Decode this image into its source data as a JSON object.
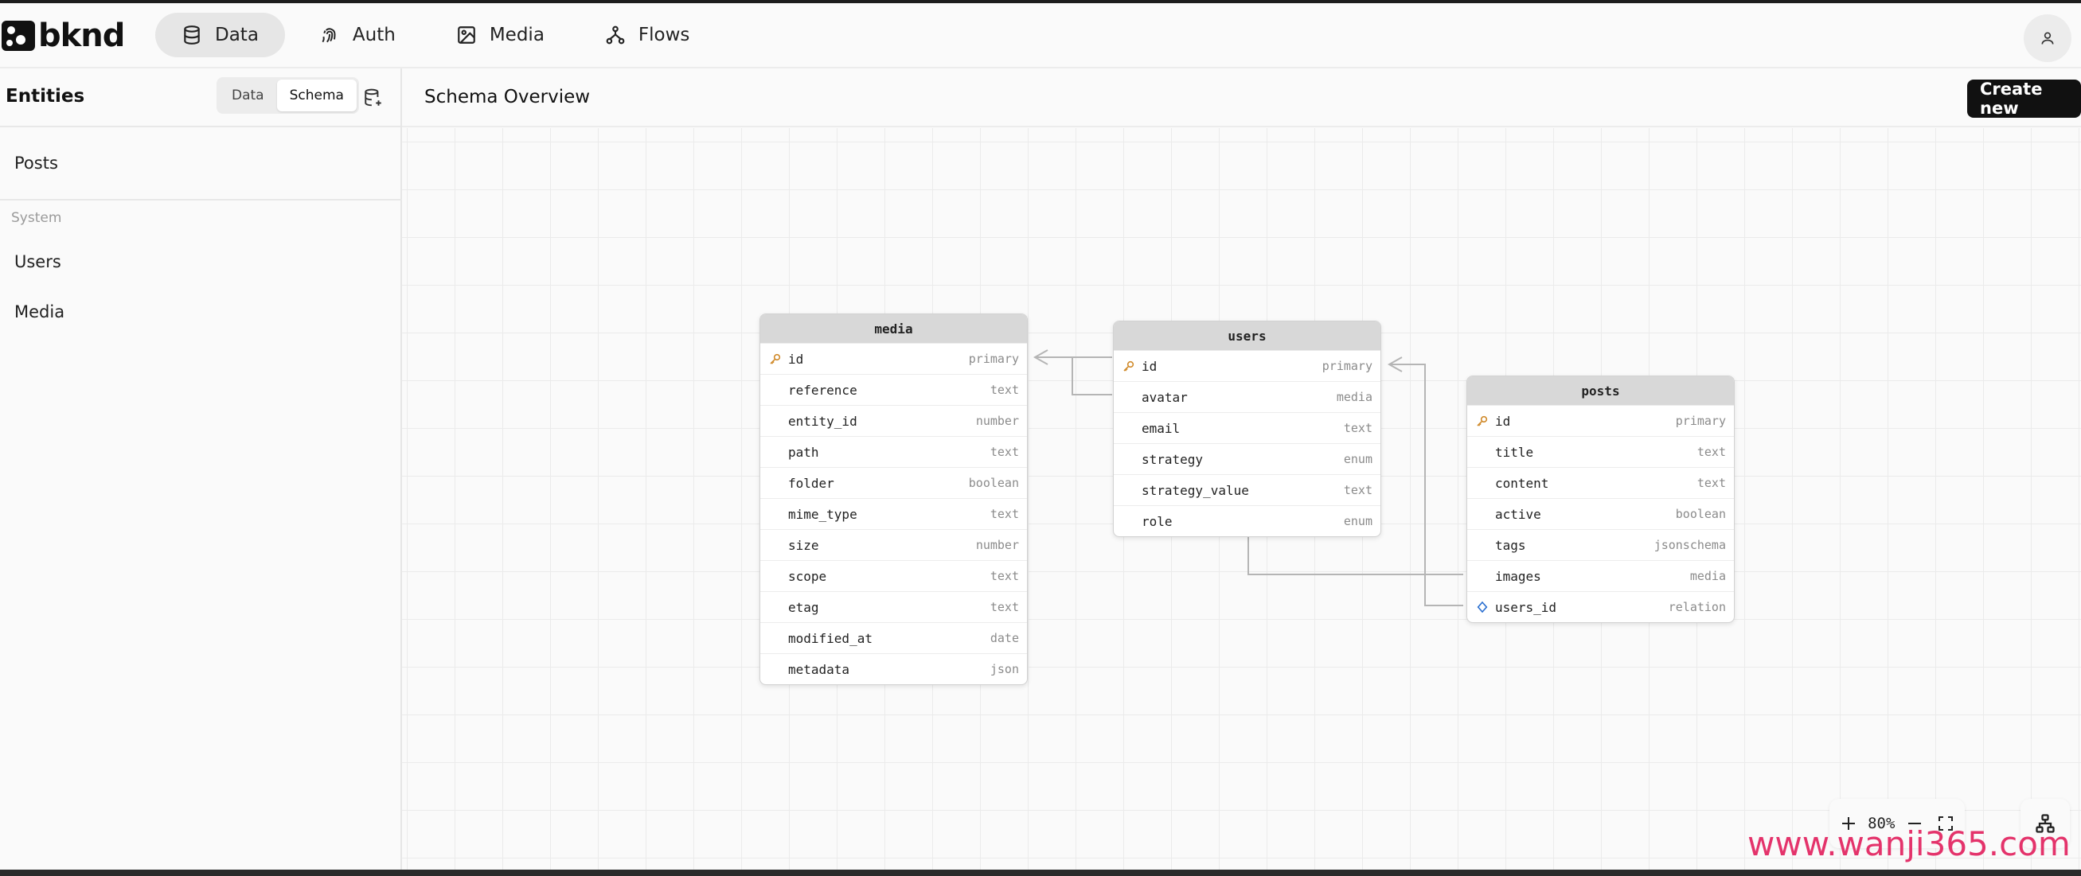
{
  "app": {
    "brand": "bknd"
  },
  "nav": [
    {
      "label": "Data",
      "icon": "database-icon",
      "active": true
    },
    {
      "label": "Auth",
      "icon": "fingerprint-icon",
      "active": false
    },
    {
      "label": "Media",
      "icon": "image-icon",
      "active": false
    },
    {
      "label": "Flows",
      "icon": "flow-icon",
      "active": false
    }
  ],
  "sidebar": {
    "title": "Entities",
    "view_toggle": {
      "data_label": "Data",
      "schema_label": "Schema",
      "selected": "Schema"
    },
    "items": [
      {
        "label": "Posts"
      }
    ],
    "system_section": "System",
    "system_items": [
      {
        "label": "Users"
      },
      {
        "label": "Media"
      }
    ]
  },
  "main": {
    "title": "Schema Overview",
    "create_label": "Create new"
  },
  "schema": {
    "media": {
      "name": "media",
      "fields": [
        {
          "name": "id",
          "type": "primary",
          "icon": "key-icon"
        },
        {
          "name": "reference",
          "type": "text"
        },
        {
          "name": "entity_id",
          "type": "number"
        },
        {
          "name": "path",
          "type": "text"
        },
        {
          "name": "folder",
          "type": "boolean"
        },
        {
          "name": "mime_type",
          "type": "text"
        },
        {
          "name": "size",
          "type": "number"
        },
        {
          "name": "scope",
          "type": "text"
        },
        {
          "name": "etag",
          "type": "text"
        },
        {
          "name": "modified_at",
          "type": "date"
        },
        {
          "name": "metadata",
          "type": "json"
        }
      ]
    },
    "users": {
      "name": "users",
      "fields": [
        {
          "name": "id",
          "type": "primary",
          "icon": "key-icon"
        },
        {
          "name": "avatar",
          "type": "media"
        },
        {
          "name": "email",
          "type": "text"
        },
        {
          "name": "strategy",
          "type": "enum"
        },
        {
          "name": "strategy_value",
          "type": "text"
        },
        {
          "name": "role",
          "type": "enum"
        }
      ]
    },
    "posts": {
      "name": "posts",
      "fields": [
        {
          "name": "id",
          "type": "primary",
          "icon": "key-icon"
        },
        {
          "name": "title",
          "type": "text"
        },
        {
          "name": "content",
          "type": "text"
        },
        {
          "name": "active",
          "type": "boolean"
        },
        {
          "name": "tags",
          "type": "jsonschema"
        },
        {
          "name": "images",
          "type": "media"
        },
        {
          "name": "users_id",
          "type": "relation",
          "icon": "diamond-icon"
        }
      ]
    }
  },
  "zoom": {
    "level": "80%"
  },
  "watermark": "www.wanji365.com",
  "colors": {
    "accent": "#111111",
    "key": "#d08a2a",
    "relation": "#2a6fd0",
    "edge": "#b5b5b5"
  }
}
